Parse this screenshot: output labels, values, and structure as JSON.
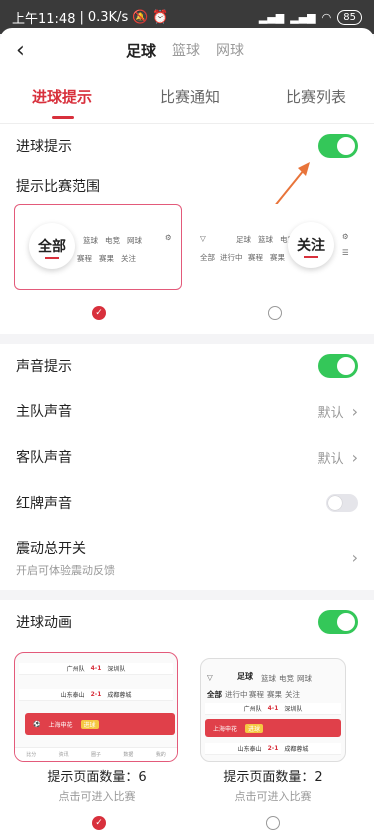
{
  "status_bar": {
    "time": "上午11:48",
    "speed": "0.3K/s",
    "battery": "85"
  },
  "nav": {
    "back_icon": "chevron-left-icon",
    "sport_tabs": [
      {
        "label": "足球",
        "active": true
      },
      {
        "label": "篮球",
        "active": false
      },
      {
        "label": "网球",
        "active": false
      }
    ]
  },
  "sub_tabs": [
    {
      "label": "进球提示",
      "active": true
    },
    {
      "label": "比赛通知",
      "active": false
    },
    {
      "label": "比赛列表",
      "active": false
    }
  ],
  "goal_alert": {
    "label": "进球提示",
    "enabled": true
  },
  "scope": {
    "title": "提示比赛范围",
    "options": [
      {
        "big_label": "全部",
        "tabs": [
          "篮球",
          "电竞",
          "网球"
        ],
        "sub_tabs": [
          "赛程",
          "赛果",
          "关注"
        ],
        "selected": true
      },
      {
        "big_label": "关注",
        "tabs": [
          "足球",
          "篮球",
          "电竞"
        ],
        "sub_tabs": [
          "全部",
          "进行中",
          "赛程",
          "赛果"
        ],
        "selected": false
      }
    ]
  },
  "sound": {
    "label": "声音提示",
    "enabled": true,
    "home_label": "主队声音",
    "home_value": "默认",
    "away_label": "客队声音",
    "away_value": "默认",
    "red_card_label": "红牌声音",
    "red_card_enabled": false
  },
  "vibration": {
    "label": "震动总开关",
    "sub": "开启可体验震动反馈"
  },
  "animation": {
    "label": "进球动画",
    "enabled": true,
    "previews": [
      {
        "caption": "提示页面数量：6",
        "sub": "点击可进入比赛",
        "selected": true,
        "rows": [
          {
            "home": "广州队",
            "score": "4-1",
            "away": "深圳队"
          },
          {
            "home": "山东泰山",
            "score": "2-1",
            "away": "成都蓉城"
          },
          {
            "home": "上海申花",
            "score": "进球",
            "away": ""
          }
        ],
        "bottom_nav": [
          "比分",
          "资讯",
          "圈子",
          "数据",
          "我的"
        ]
      },
      {
        "caption": "提示页面数量：2",
        "sub": "点击可进入比赛",
        "selected": false,
        "header": {
          "title": "足球",
          "tabs": [
            "篮球",
            "电竞",
            "网球"
          ],
          "filters": [
            "全部",
            "进行中",
            "赛程",
            "赛果",
            "关注"
          ]
        },
        "rows": [
          {
            "home": "广州队",
            "score": "4-1",
            "away": "深圳队"
          },
          {
            "home": "上海申花",
            "score": "进球",
            "away": ""
          },
          {
            "home": "山东泰山",
            "score": "2-1",
            "away": "成都蓉城"
          }
        ]
      }
    ]
  },
  "colors": {
    "accent": "#d8303c",
    "toggle_on": "#34c759",
    "select_border": "#e35a7a"
  }
}
